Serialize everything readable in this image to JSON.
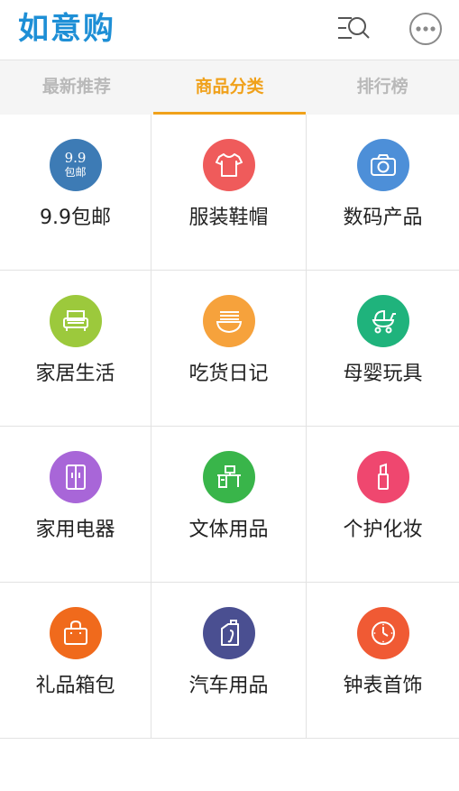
{
  "app": {
    "title": "如意购"
  },
  "header": {
    "search_icon": "search-list-icon",
    "more_icon": "more-dots-icon"
  },
  "tabs": [
    {
      "label": "最新推荐",
      "active": false
    },
    {
      "label": "商品分类",
      "active": true
    },
    {
      "label": "排行榜",
      "active": false
    }
  ],
  "colors": {
    "brand": "#1e8fd6",
    "active_tab": "#f0a11b"
  },
  "badge": {
    "price": "9.9",
    "text": "包邮"
  },
  "categories": [
    {
      "label": "9.9包邮",
      "icon": "price-badge-icon",
      "color": "#3d7bb5"
    },
    {
      "label": "服装鞋帽",
      "icon": "tshirt-icon",
      "color": "#ef5b5b"
    },
    {
      "label": "数码产品",
      "icon": "camera-icon",
      "color": "#4d8fd8"
    },
    {
      "label": "家居生活",
      "icon": "sofa-icon",
      "color": "#9cc93c"
    },
    {
      "label": "吃货日记",
      "icon": "noodle-bowl-icon",
      "color": "#f6a23c"
    },
    {
      "label": "母婴玩具",
      "icon": "stroller-icon",
      "color": "#1fb37c"
    },
    {
      "label": "家用电器",
      "icon": "fridge-icon",
      "color": "#a866d8"
    },
    {
      "label": "文体用品",
      "icon": "desk-icon",
      "color": "#39b54a"
    },
    {
      "label": "个护化妆",
      "icon": "lipstick-icon",
      "color": "#ef476f"
    },
    {
      "label": "礼品箱包",
      "icon": "handbag-icon",
      "color": "#f06a1c"
    },
    {
      "label": "汽车用品",
      "icon": "oil-bottle-icon",
      "color": "#4a4f91"
    },
    {
      "label": "钟表首饰",
      "icon": "clock-icon",
      "color": "#f05a34"
    }
  ]
}
